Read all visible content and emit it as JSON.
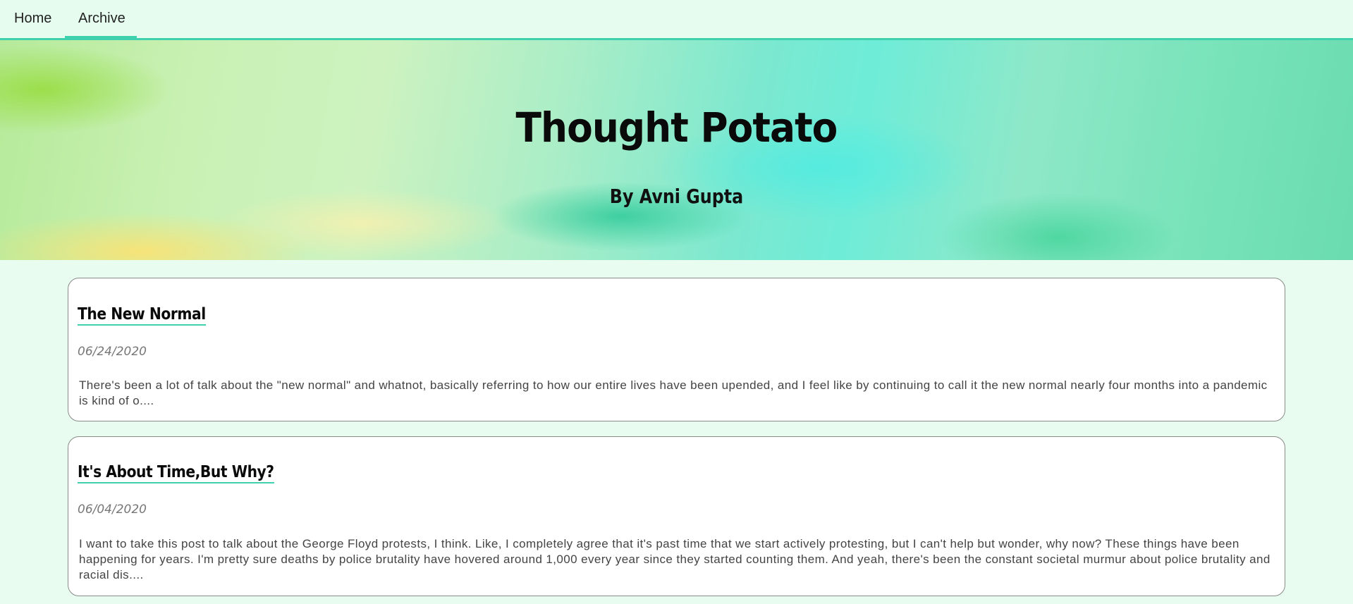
{
  "nav": {
    "items": [
      {
        "label": "Home"
      },
      {
        "label": "Archive"
      }
    ],
    "accent_color": "#3fd1ae"
  },
  "hero": {
    "title": "Thought Potato",
    "subtitle": "By Avni Gupta"
  },
  "posts": [
    {
      "title": "The New Normal",
      "date": "06/24/2020",
      "excerpt": "There's been a lot of talk about the \"new normal\" and whatnot, basically referring to how our entire lives have been upended, and I feel like by continuing to call it the new normal nearly four months into a pandemic is kind of o...."
    },
    {
      "title": "It's About Time,But Why?",
      "date": "06/04/2020",
      "excerpt": "I want to take this post to talk about the George Floyd protests, I think. Like, I completely agree that it's past time that we start actively protesting, but I can't help but wonder, why now? These things have been happening for years. I'm pretty sure deaths by police brutality have hovered around 1,000 every year since they started counting them. And yeah, there's been the constant societal murmur about police brutality and racial dis...."
    }
  ]
}
